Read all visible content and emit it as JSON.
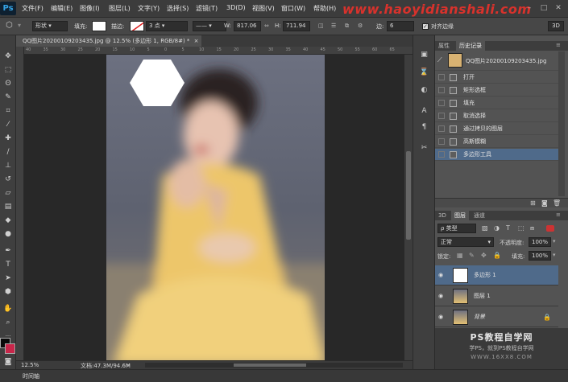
{
  "app": {
    "logo": "Ps"
  },
  "menu": [
    "文件(F)",
    "编辑(E)",
    "图像(I)",
    "图层(L)",
    "文字(Y)",
    "选择(S)",
    "滤镜(T)",
    "3D(D)",
    "视图(V)",
    "窗口(W)",
    "帮助(H)"
  ],
  "watermark_top": "www.haoyidianshali.com",
  "options": {
    "shape_mode": "形状",
    "fill_label": "填充:",
    "stroke_label": "描边:",
    "stroke_size": "3 点",
    "w_label": "W:",
    "w_value": "817.06",
    "h_label": "H:",
    "h_value": "711.94",
    "edges_label": "边:",
    "edges_value": "6",
    "align_edges_label": "对齐边缘",
    "mode_3d": "3D"
  },
  "document": {
    "tab_title": "QQ图片20200109203435.jpg @ 12.5% (多边形 1, RGB/8#) *",
    "close_glyph": "×"
  },
  "ruler_ticks": [
    "40",
    "35",
    "30",
    "25",
    "20",
    "15",
    "10",
    "5",
    "0",
    "5",
    "10",
    "15",
    "20",
    "25",
    "30",
    "35",
    "40",
    "45",
    "50",
    "55",
    "60",
    "65"
  ],
  "status": {
    "zoom": "12.5%",
    "doc": "文档:47.3M/94.6M"
  },
  "bottom_tab": "时间轴",
  "history_panel": {
    "tabs": [
      "属性",
      "历史记录"
    ],
    "snapshot": "QQ图片20200109203435.jpg",
    "items": [
      "打开",
      "矩形选框",
      "填充",
      "取消选择",
      "通过拷贝的图层",
      "高斯模糊",
      "多边形工具"
    ],
    "active_index": 6
  },
  "layers_panel": {
    "tabs": [
      "3D",
      "图层",
      "通道"
    ],
    "kind_label": "ρ 类型",
    "blend_mode": "正常",
    "opacity_label": "不透明度:",
    "opacity_value": "100%",
    "lock_label": "锁定:",
    "fill_label": "填充:",
    "fill_value": "100%",
    "layers": [
      {
        "name": "多边形 1",
        "type": "shape",
        "selected": true
      },
      {
        "name": "图层 1",
        "type": "photo",
        "selected": false
      },
      {
        "name": "背景",
        "type": "photo",
        "selected": false,
        "locked": true
      }
    ]
  },
  "watermark_bottom": {
    "title": "PS教程自学网",
    "subtitle": "学PS，就到PS教程自学网",
    "url": "WWW.16XX8.COM"
  },
  "colors": {
    "accent": "#4f6a8a",
    "ps_blue": "#35a4e6",
    "watermark_red": "#d8322c"
  }
}
